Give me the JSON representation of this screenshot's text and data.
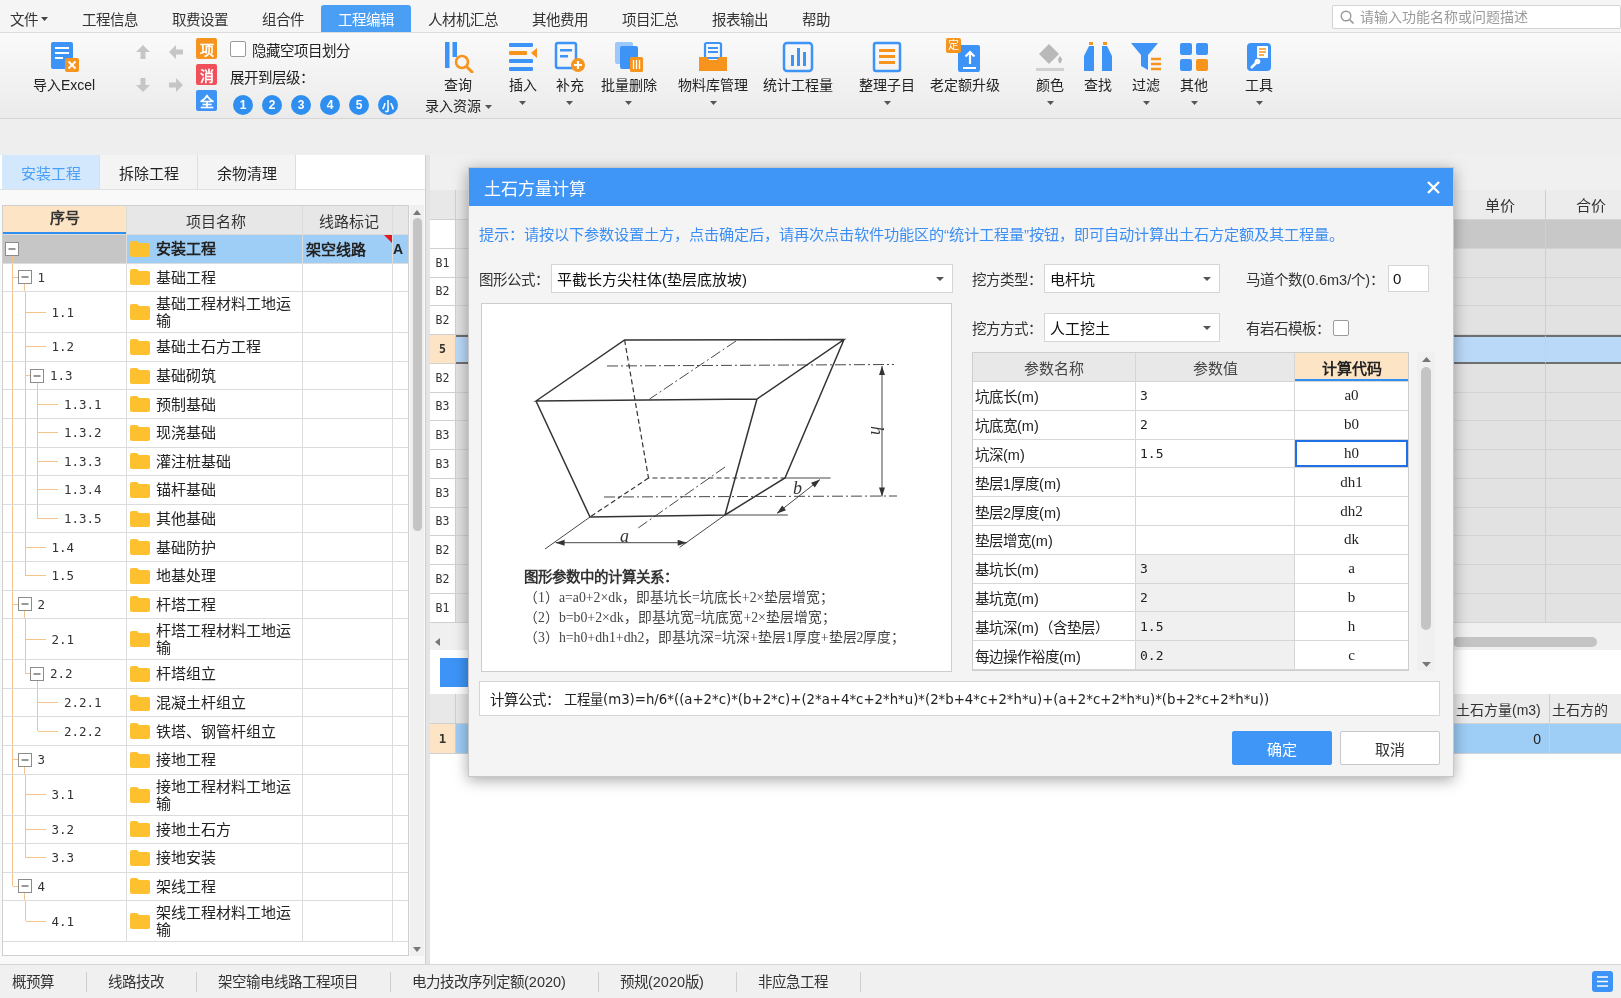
{
  "menu_bar": {
    "items": [
      {
        "label": "文件",
        "dropdown": true,
        "selected": false
      },
      {
        "label": "工程信息",
        "dropdown": false,
        "selected": false
      },
      {
        "label": "取费设置",
        "dropdown": false,
        "selected": false
      },
      {
        "label": "组合件",
        "dropdown": false,
        "selected": false
      },
      {
        "label": "工程编辑",
        "dropdown": false,
        "selected": true
      },
      {
        "label": "人材机汇总",
        "dropdown": false,
        "selected": false
      },
      {
        "label": "其他费用",
        "dropdown": false,
        "selected": false
      },
      {
        "label": "项目汇总",
        "dropdown": false,
        "selected": false
      },
      {
        "label": "报表输出",
        "dropdown": false,
        "selected": false
      },
      {
        "label": "帮助",
        "dropdown": false,
        "selected": false
      }
    ],
    "search": {
      "placeholder": "请输入功能名称或问题描述"
    }
  },
  "ribbon": {
    "import": {
      "label": "导入Excel"
    },
    "arrows": [
      {
        "kind": "up",
        "disabled": true
      },
      {
        "kind": "left",
        "disabled": true
      },
      {
        "kind": "down",
        "disabled": true
      },
      {
        "kind": "right",
        "disabled": true
      }
    ],
    "tiles": [
      {
        "label": "项",
        "color": "#f7941d"
      },
      {
        "label": "消",
        "color": "#f0505a"
      },
      {
        "label": "全",
        "color": "#3d94f6"
      }
    ],
    "hide_empty": {
      "label": "隐藏空项目划分",
      "checked": false
    },
    "expand_level": {
      "label": "展开到层级：",
      "levels": [
        "1",
        "2",
        "3",
        "4",
        "5",
        "小"
      ]
    },
    "groups": [
      {
        "buttons": [
          {
            "label": "查询",
            "sub_label": "录入资源",
            "dropdown": true
          },
          {
            "label": "插入",
            "dropdown": true
          },
          {
            "label": "补充",
            "dropdown": true
          },
          {
            "label": "批量删除",
            "dropdown": true
          }
        ]
      },
      {
        "buttons": [
          {
            "label": "物料库管理",
            "dropdown": true
          },
          {
            "label": "统计工程量",
            "dropdown": false
          }
        ]
      },
      {
        "buttons": [
          {
            "label": "整理子目",
            "dropdown": true
          },
          {
            "label": "老定额升级",
            "dropdown": false,
            "badge": "定"
          }
        ]
      },
      {
        "buttons": [
          {
            "label": "颜色",
            "dropdown": true
          },
          {
            "label": "查找",
            "dropdown": false
          },
          {
            "label": "过滤",
            "dropdown": true
          },
          {
            "label": "其他",
            "dropdown": true
          }
        ]
      },
      {
        "buttons": [
          {
            "label": "工具",
            "dropdown": true
          }
        ]
      }
    ]
  },
  "left_panel": {
    "tabs": [
      {
        "label": "安装工程",
        "selected": true
      },
      {
        "label": "拆除工程",
        "selected": false
      },
      {
        "label": "余物清理",
        "selected": false
      }
    ],
    "tree": {
      "columns": [
        {
          "label": "序号",
          "selected": true
        },
        {
          "label": "项目名称",
          "selected": false
        },
        {
          "label": "线路标记",
          "selected": false
        }
      ],
      "nodes": [
        {
          "name": "安装工程",
          "marker": "架空线路",
          "column_4": "A",
          "expanded": true,
          "selected": true,
          "flagged": true,
          "children": [
            {
              "seq": "1",
              "name": "基础工程",
              "expanded": true,
              "selected": false,
              "flagged": false,
              "children": [
                {
                  "seq": "1.1",
                  "name": "基础工程材料工地运输",
                  "selected": false,
                  "flagged": false
                },
                {
                  "seq": "1.2",
                  "name": "基础土石方工程",
                  "selected": false,
                  "flagged": false
                },
                {
                  "seq": "1.3",
                  "name": "基础砌筑",
                  "expanded": true,
                  "selected": false,
                  "flagged": false,
                  "children": [
                    {
                      "seq": "1.3.1",
                      "name": "预制基础",
                      "selected": false,
                      "flagged": false
                    },
                    {
                      "seq": "1.3.2",
                      "name": "现浇基础",
                      "selected": false,
                      "flagged": false
                    },
                    {
                      "seq": "1.3.3",
                      "name": "灌注桩基础",
                      "selected": false,
                      "flagged": false
                    },
                    {
                      "seq": "1.3.4",
                      "name": "锚杆基础",
                      "selected": false,
                      "flagged": false
                    },
                    {
                      "seq": "1.3.5",
                      "name": "其他基础",
                      "selected": false,
                      "flagged": false
                    }
                  ]
                },
                {
                  "seq": "1.4",
                  "name": "基础防护",
                  "selected": false,
                  "flagged": false
                },
                {
                  "seq": "1.5",
                  "name": "地基处理",
                  "selected": false,
                  "flagged": false
                }
              ]
            },
            {
              "seq": "2",
              "name": "杆塔工程",
              "expanded": true,
              "selected": false,
              "flagged": false,
              "children": [
                {
                  "seq": "2.1",
                  "name": "杆塔工程材料工地运输",
                  "selected": false,
                  "flagged": false
                },
                {
                  "seq": "2.2",
                  "name": "杆塔组立",
                  "expanded": true,
                  "selected": false,
                  "flagged": false,
                  "children": [
                    {
                      "seq": "2.2.1",
                      "name": "混凝土杆组立",
                      "selected": false,
                      "flagged": false
                    },
                    {
                      "seq": "2.2.2",
                      "name": "铁塔、钢管杆组立",
                      "selected": false,
                      "flagged": false
                    }
                  ]
                }
              ]
            },
            {
              "seq": "3",
              "name": "接地工程",
              "expanded": true,
              "selected": false,
              "flagged": false,
              "children": [
                {
                  "seq": "3.1",
                  "name": "接地工程材料工地运输",
                  "selected": false,
                  "flagged": false
                },
                {
                  "seq": "3.2",
                  "name": "接地土石方",
                  "selected": false,
                  "flagged": false
                },
                {
                  "seq": "3.3",
                  "name": "接地安装",
                  "selected": false,
                  "flagged": false
                }
              ]
            },
            {
              "seq": "4",
              "name": "架线工程",
              "expanded": true,
              "selected": false,
              "flagged": false,
              "children": [
                {
                  "seq": "4.1",
                  "name": "架线工程材料工地运输",
                  "selected": false,
                  "flagged": false
                }
              ]
            }
          ]
        }
      ]
    }
  },
  "main_area": {
    "grid": {
      "columns": [
        "单价",
        "合价"
      ],
      "rows": [
        {
          "kind": "summary",
          "selected": false
        },
        {
          "code": "B1",
          "kind": "item",
          "selected": false
        },
        {
          "code": "B2",
          "kind": "item",
          "selected": false
        },
        {
          "code": "B2",
          "kind": "item",
          "selected": false
        },
        {
          "code": "5",
          "kind": "item",
          "selected": true
        },
        {
          "code": "B2",
          "kind": "item",
          "selected": false
        },
        {
          "code": "B3",
          "kind": "item",
          "selected": false
        },
        {
          "code": "B3",
          "kind": "item",
          "selected": false
        },
        {
          "code": "B3",
          "kind": "item",
          "selected": false
        },
        {
          "code": "B3",
          "kind": "item",
          "selected": false
        },
        {
          "code": "B3",
          "kind": "item",
          "selected": false
        },
        {
          "code": "B2",
          "kind": "item",
          "selected": false
        },
        {
          "code": "B2",
          "kind": "item",
          "selected": false
        },
        {
          "code": "B1",
          "kind": "item",
          "selected": false
        }
      ]
    },
    "lower_grid": {
      "tabs": [
        {
          "selected": true
        }
      ],
      "columns": [
        "土石方量(m3)",
        "土石方的"
      ],
      "rows": [
        {
          "number": "1",
          "quantity": "0",
          "selected": true
        }
      ]
    }
  },
  "dialog": {
    "title": "土石方量计算",
    "hint": "提示：请按以下参数设置土方，点击确定后，请再次点击软件功能区的“统计工程量”按钮，即可自动计算出土石方定额及其工程量。",
    "shape_formula": {
      "label": "图形公式：",
      "value": "平截长方尖柱体(垫层底放坡)"
    },
    "dig_type": {
      "label": "挖方类型：",
      "value": "电杆坑"
    },
    "ramp_count": {
      "label": "马道个数(0.6m3/个)：",
      "value": "0"
    },
    "dig_method": {
      "label": "挖方方式：",
      "value": "人工挖土"
    },
    "rock_template": {
      "label": "有岩石模板：",
      "checked": false
    },
    "figure": {
      "dimension_labels": [
        "a",
        "b",
        "h"
      ],
      "caption": "图形参数中的计算关系：",
      "lines": [
        "（1）a=a0+2×dk，即基坑长=坑底长+2×垫层增宽；",
        "（2）b=b0+2×dk，即基坑宽=坑底宽+2×垫层增宽；",
        "（3）h=h0+dh1+dh2，即基坑深=坑深+垫层1厚度+垫层2厚度；"
      ]
    },
    "params": {
      "columns": [
        {
          "label": "参数名称",
          "selected": false
        },
        {
          "label": "参数值",
          "selected": false
        },
        {
          "label": "计算代码",
          "selected": true
        }
      ],
      "rows": [
        {
          "name": "坑底长(m)",
          "value": "3",
          "code": "a0",
          "readonly": false,
          "selected": false
        },
        {
          "name": "坑底宽(m)",
          "value": "2",
          "code": "b0",
          "readonly": false,
          "selected": false
        },
        {
          "name": "坑深(m)",
          "value": "1.5",
          "code": "h0",
          "readonly": false,
          "selected": true
        },
        {
          "name": "垫层1厚度(m)",
          "code": "dh1",
          "readonly": false,
          "selected": false
        },
        {
          "name": "垫层2厚度(m)",
          "code": "dh2",
          "readonly": false,
          "selected": false
        },
        {
          "name": "垫层增宽(m)",
          "code": "dk",
          "readonly": false,
          "selected": false
        },
        {
          "name": "基坑长(m)",
          "value": "3",
          "code": "a",
          "readonly": true,
          "selected": false
        },
        {
          "name": "基坑宽(m)",
          "value": "2",
          "code": "b",
          "readonly": true,
          "selected": false
        },
        {
          "name": "基坑深(m)（含垫层）",
          "value": "1.5",
          "code": "h",
          "readonly": true,
          "selected": false
        },
        {
          "name": "每边操作裕度(m)",
          "value": "0.2",
          "code": "c",
          "readonly": true,
          "selected": false
        }
      ]
    },
    "formula": {
      "label": "计算公式：",
      "value": "工程量(m3)=h/6*((a+2*c)*(b+2*c)+(2*a+4*c+2*h*u)*(2*b+4*c+2*h*u)+(a+2*c+2*h*u)*(b+2*c+2*h*u))"
    },
    "buttons": [
      {
        "label": "确定",
        "kind": "primary"
      },
      {
        "label": "取消",
        "kind": "secondary"
      }
    ]
  },
  "status_bar": {
    "items": [
      "概预算",
      "线路技改",
      "架空输电线路工程项目",
      "电力技改序列定额(2020)",
      "预规(2020版)",
      "非应急工程"
    ]
  }
}
